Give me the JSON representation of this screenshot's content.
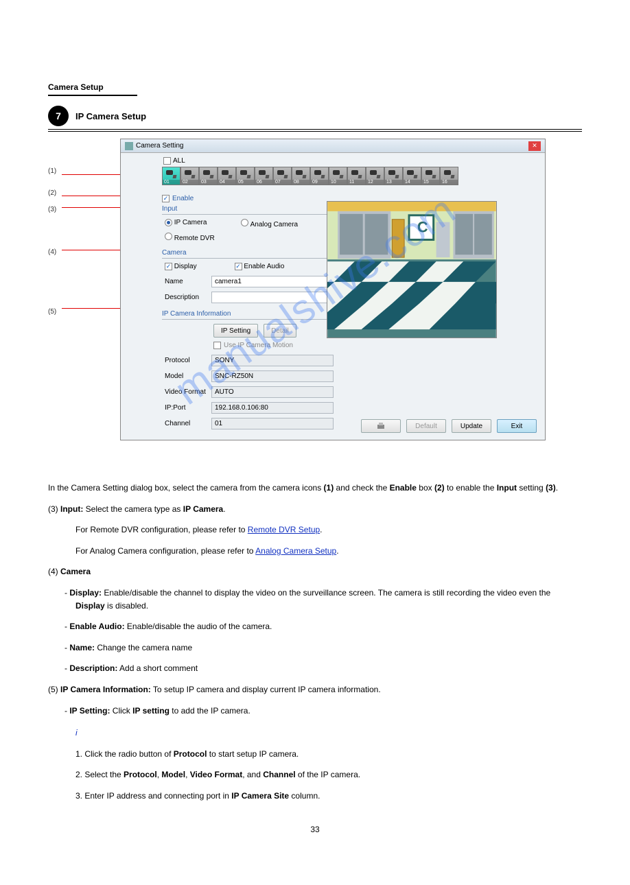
{
  "section_header": "Camera Setup",
  "bullet_num": "7",
  "title": "IP Camera Setup",
  "dialog_title": "Camera Setting",
  "all_label": "ALL",
  "camera_nums": [
    "01",
    "02",
    "03",
    "04",
    "05",
    "06",
    "07",
    "08",
    "09",
    "10",
    "11",
    "12",
    "13",
    "14",
    "15",
    "16"
  ],
  "enable_label": "Enable",
  "group_input": "Input",
  "radio_ip": "IP Camera",
  "radio_analog": "Analog Camera",
  "radio_remote": "Remote DVR",
  "group_camera": "Camera",
  "chk_display": "Display",
  "chk_enable_audio": "Enable Audio",
  "lbl_name": "Name",
  "val_name": "camera1",
  "lbl_desc": "Description",
  "val_desc": "",
  "group_ipinfo": "IP Camera Information",
  "btn_ipsetting": "IP Setting",
  "btn_detail": "Detail",
  "chk_use_motion": "Use IP Camera Motion",
  "lbl_protocol": "Protocol",
  "val_protocol": "SONY",
  "lbl_model": "Model",
  "val_model": "SNC-RZ50N",
  "lbl_vformat": "Video Format",
  "val_vformat": "AUTO",
  "lbl_ipport": "IP:Port",
  "val_ipport": "192.168.0.106:80",
  "lbl_channel": "Channel",
  "val_channel": "01",
  "btn_default": "Default",
  "btn_update": "Update",
  "btn_exit": "Exit",
  "callouts": {
    "c1": "(1)",
    "c2": "(2)",
    "c3": "(3)",
    "c4": "(4)",
    "c5": "(5)"
  },
  "watermark": "manualshive.com",
  "para1_pre": "In the Camera Setting dialog box, select the camera from the camera icons ",
  "para1_mid1": " and check the ",
  "para1_bold1": "Enable",
  "para1_mid2": " box ",
  "para1_mid3": " to enable the ",
  "para1_bold2": "Input",
  "para1_mid4": " setting ",
  "para1_end": ".",
  "c_ref1": "(1)",
  "c_ref2": "(2)",
  "c_ref3": "(3)",
  "item3_pre": "(3)  ",
  "item3_b": "Input:",
  "item3_txt": " Select the camera type as ",
  "item3_b2": "IP Camera",
  "item3_end": ".",
  "remote_pre": "For Remote DVR configuration, please refer to ",
  "remote_link": "Remote DVR Setup",
  "remote_end": ".",
  "analog_pre": "For Analog Camera configuration, please refer to ",
  "analog_link": "Analog Camera Setup",
  "analog_end": ".",
  "item4_pre": "(4)  ",
  "item4_b": "Camera",
  "display_dash": "-  ",
  "display_b": "Display:",
  "display_txt": " Enable/disable the channel to display the video on the surveillance screen. The camera is still recording the video even the ",
  "display_b2": "Display",
  "display_txt2": " is disabled.",
  "audio_b": "Enable Audio:",
  "audio_txt": " Enable/disable the audio of the camera.",
  "name_b": "Name:",
  "name_txt": " Change the camera name",
  "desc_b": "Description:",
  "desc_txt": " Add a short comment",
  "item5_pre": "(5)  ",
  "item5_b": "IP Camera Information:",
  "item5_txt": " To setup IP camera and display current IP camera information.",
  "ipset_b": "IP Setting:",
  "ipset_txt": " Click ",
  "ipset_b2": "IP setting",
  "ipset_txt2": " to add the IP camera.",
  "blue_i_label": "i",
  "step1": "1.  Click the radio button of ",
  "step1_b": "Protocol",
  "step1_txt": " to start setup IP camera.",
  "step2": "2.  Select the ",
  "step2_b1": "Protocol",
  "step2_m": ", ",
  "step2_b2": "Model",
  "step2_m2": ", ",
  "step2_b3": "Video Format",
  "step2_m3": ", and ",
  "step2_b4": "Channel",
  "step2_end": " of the IP camera.",
  "step3": "3.  Enter IP address and connecting port in ",
  "step3_b": "IP Camera Site",
  "step3_end": " column.",
  "pagenum": "33"
}
